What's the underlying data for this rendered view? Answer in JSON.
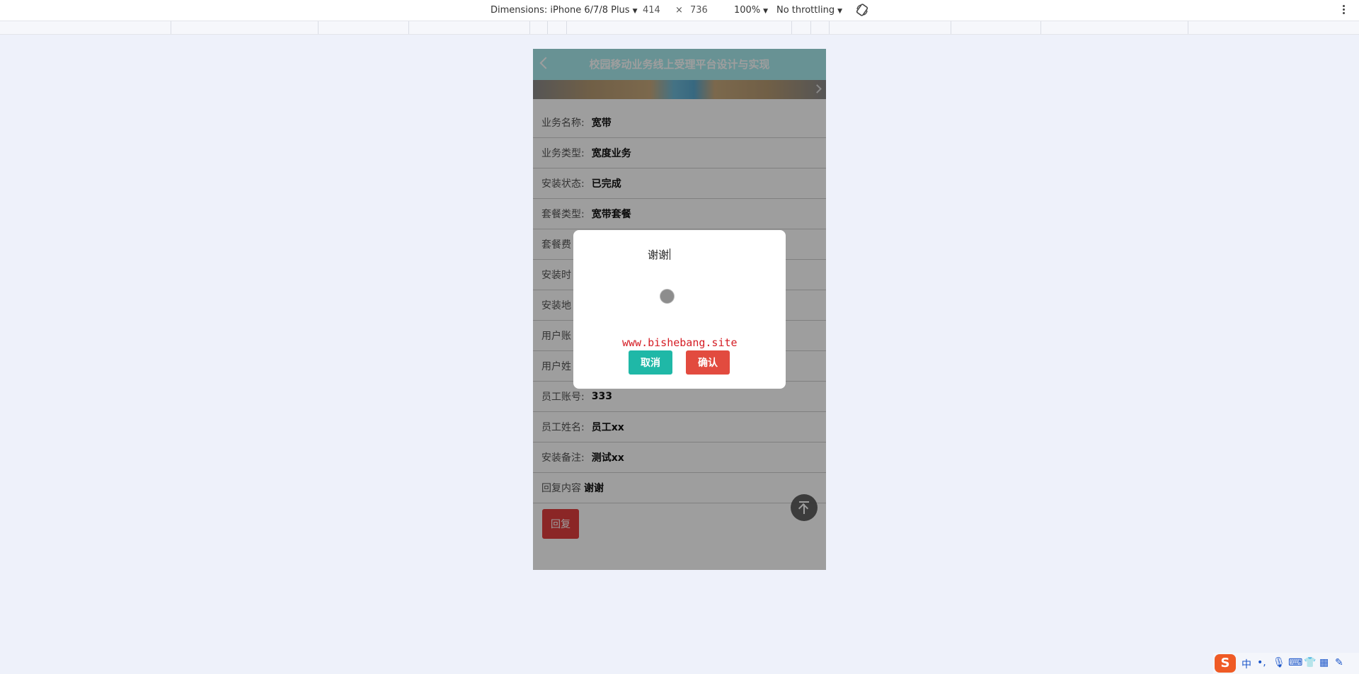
{
  "devtools": {
    "dimensions_label": "Dimensions: iPhone 6/7/8 Plus",
    "width": "414",
    "times": "×",
    "height": "736",
    "zoom": "100%",
    "throttle": "No throttling"
  },
  "app": {
    "title": "校园移动业务线上受理平台设计与实现",
    "fields": [
      {
        "label": "业务名称:",
        "value": "宽带"
      },
      {
        "label": "业务类型:",
        "value": "宽度业务"
      },
      {
        "label": "安装状态:",
        "value": "已完成"
      },
      {
        "label": "套餐类型:",
        "value": "宽带套餐"
      },
      {
        "label": "套餐费",
        "value": ""
      },
      {
        "label": "安装时",
        "value": ""
      },
      {
        "label": "安装地",
        "value": ""
      },
      {
        "label": "用户账",
        "value": ""
      },
      {
        "label": "用户姓",
        "value": ""
      },
      {
        "label": "员工账号:",
        "value": "333"
      },
      {
        "label": "员工姓名:",
        "value": "员工xx"
      },
      {
        "label": "安装备注:",
        "value": "测试xx"
      },
      {
        "label": "回复内容",
        "value": "谢谢"
      }
    ],
    "reply_button": "回复"
  },
  "dialog": {
    "input_text": "谢谢",
    "watermark": "www.bishebang.site",
    "cancel": "取消",
    "confirm": "确认"
  },
  "ime": {
    "logo": "S",
    "lang": "中"
  }
}
